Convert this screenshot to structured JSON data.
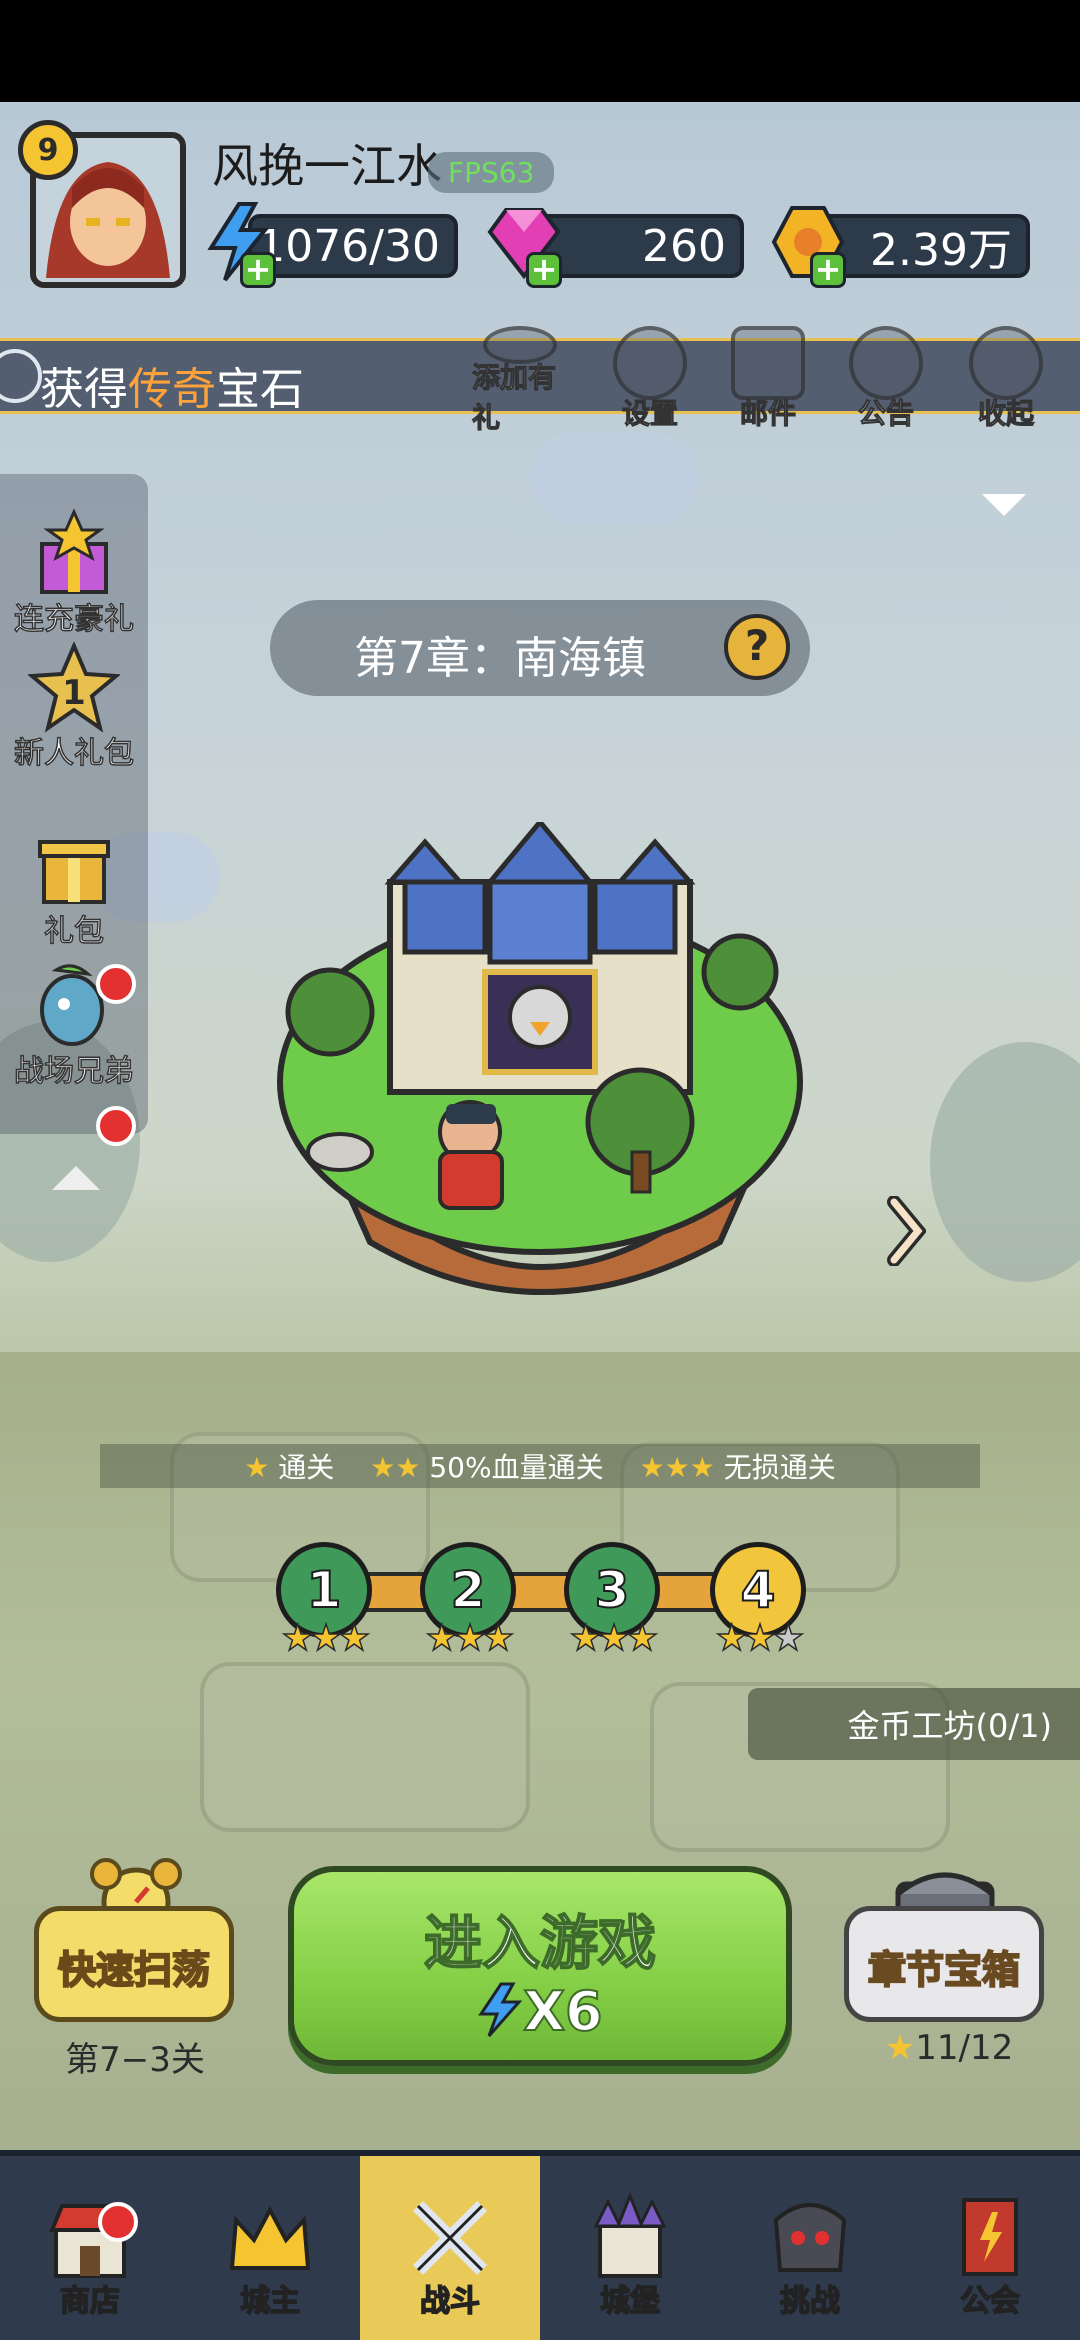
{
  "player": {
    "name": "风挽一江水",
    "level": "9",
    "fps": "FPS63"
  },
  "resources": {
    "energy": "1076/30",
    "gems": "260",
    "gold": "2.39万"
  },
  "ticker": {
    "prefix": "获得",
    "highlight": "传奇",
    "suffix": "宝石"
  },
  "top_buttons": [
    "添加有礼",
    "设置",
    "邮件",
    "公告",
    "收起"
  ],
  "sidebar": {
    "items": [
      "连充豪礼",
      "新人礼包",
      "礼包",
      "战场兄弟"
    ]
  },
  "chapter": {
    "title": "第7章：南海镇",
    "help": "?"
  },
  "legend": {
    "one_star": "通关",
    "two_star": "50%血量通关",
    "three_star": "无损通关"
  },
  "stages": [
    {
      "label": "1",
      "stars": 3
    },
    {
      "label": "2",
      "stars": 3
    },
    {
      "label": "3",
      "stars": 3
    },
    {
      "label": "4",
      "stars": 2
    }
  ],
  "workshop": "金币工坊(0/1)",
  "actions": {
    "sweep_label": "快速扫荡",
    "sweep_sub": "第7−3关",
    "enter_label": "进入游戏",
    "enter_cost": "X6",
    "chest_label": "章节宝箱",
    "chest_progress": "11/12"
  },
  "nav": [
    "商店",
    "城主",
    "战斗",
    "城堡",
    "挑战",
    "公会"
  ],
  "colors": {
    "accent_gold": "#f4c531",
    "enter_green": "#84cf46",
    "nav_bg": "#2f3a4d",
    "nav_active": "#e9c957",
    "highlight_orange": "#ffa23a"
  }
}
